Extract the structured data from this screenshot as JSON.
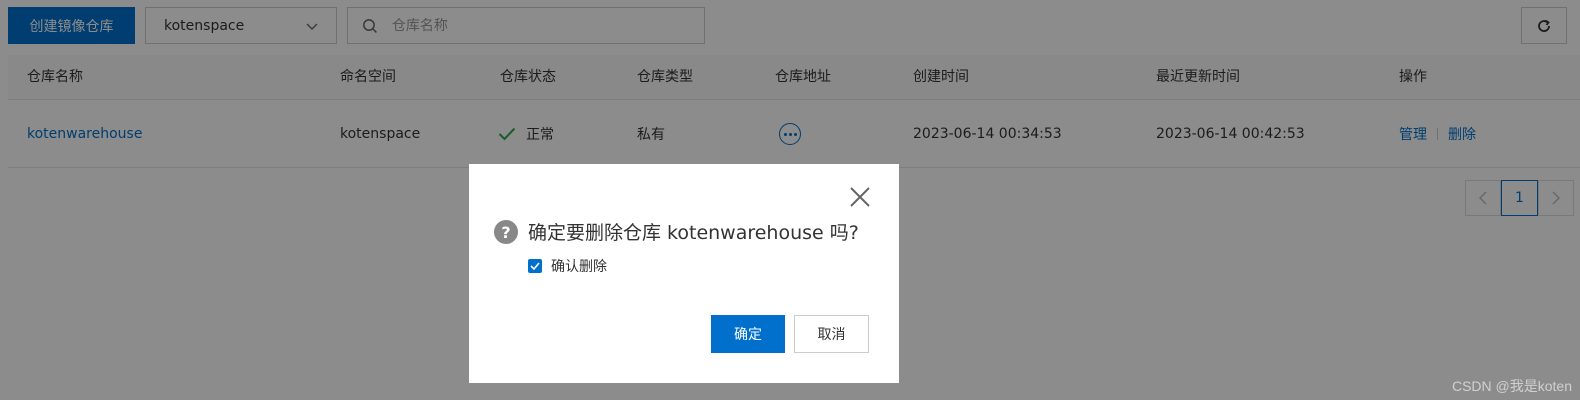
{
  "toolbar": {
    "create_label": "创建镜像仓库",
    "namespace_value": "kotenspace",
    "search_placeholder": "仓库名称"
  },
  "table": {
    "headers": [
      "仓库名称",
      "命名空间",
      "仓库状态",
      "仓库类型",
      "仓库地址",
      "创建时间",
      "最近更新时间",
      "操作"
    ],
    "rows": [
      {
        "name": "kotenwarehouse",
        "namespace": "kotenspace",
        "status": "正常",
        "type": "私有",
        "created": "2023-06-14 00:34:53",
        "updated": "2023-06-14 00:42:53",
        "action_manage": "管理",
        "action_delete": "删除"
      }
    ]
  },
  "pagination": {
    "current": "1"
  },
  "dialog": {
    "message": "确定要删除仓库 kotenwarehouse 吗?",
    "checkbox_label": "确认删除",
    "checkbox_checked": true,
    "ok_label": "确定",
    "cancel_label": "取消"
  },
  "watermark": "CSDN @我是koten",
  "colors": {
    "primary": "#0070cc",
    "success": "#2fa84f",
    "mask": "rgba(0,0,0,0.45)"
  },
  "icons": [
    "chevron-down-icon",
    "search-icon",
    "refresh-icon",
    "check-icon",
    "more-icon",
    "chevron-left-icon",
    "chevron-right-icon",
    "close-icon",
    "question-icon"
  ]
}
